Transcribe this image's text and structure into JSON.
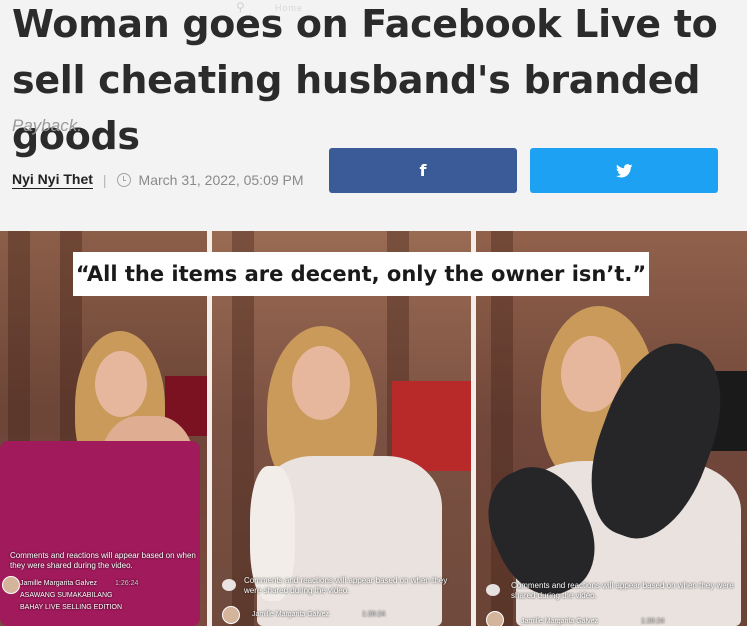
{
  "article": {
    "headline": "Woman goes on Facebook Live to sell cheating husband's branded goods",
    "subtitle": "Payback.",
    "author": "Nyi Nyi Thet",
    "separator": "|",
    "date": "March 31, 2022, 05:09 PM",
    "ghost_search_label": "Home"
  },
  "share": {
    "facebook_icon": "f",
    "twitter_icon": "🐦"
  },
  "image": {
    "quote": "“All the items are decent, only the owner isn’t.”",
    "panels": [
      {
        "comment_notice": "Comments and reactions will appear based on when they were shared during the video.",
        "commenter": "Jamille Margarita Galvez",
        "timestamp": "1:26:24",
        "caption_line1": "ASAWANG SUMAKABILANG",
        "caption_line2": "BAHAY LIVE SELLING EDITION"
      },
      {
        "comment_notice": "Comments and reactions will appear based on when they were shared during the video.",
        "commenter": "Jamille Margarita Galvez",
        "timestamp": "1:26:24"
      },
      {
        "comment_notice": "Comments and reactions will appear based on when they were shared during the video.",
        "commenter": "Jamille Margarita Galvez",
        "timestamp": "1:26:24"
      }
    ]
  },
  "colors": {
    "facebook": "#3a5a98",
    "twitter": "#1da1f2",
    "headline": "#2b2b2b"
  }
}
